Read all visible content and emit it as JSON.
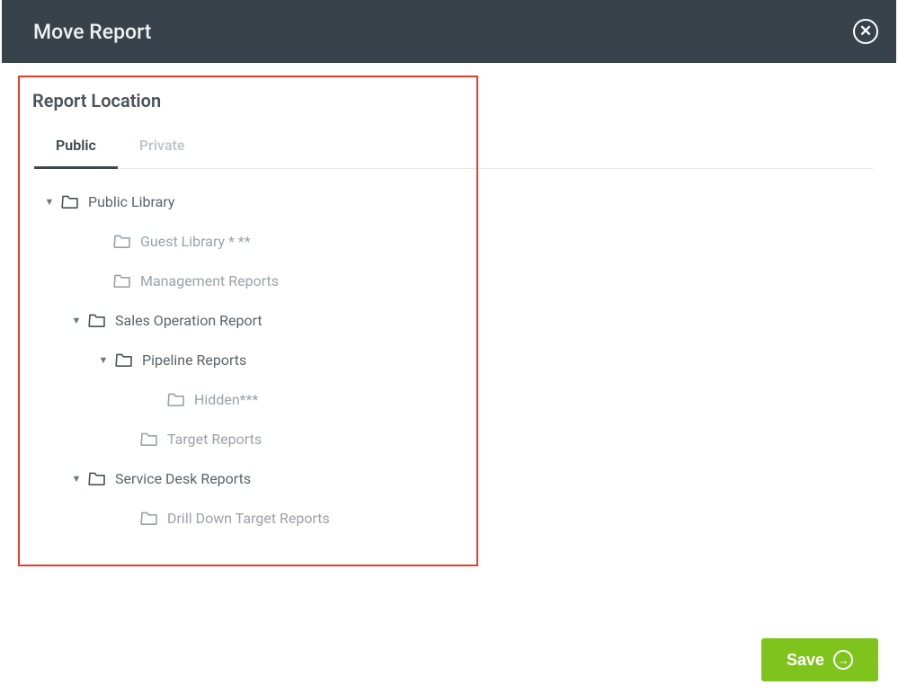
{
  "header": {
    "title": "Move Report"
  },
  "section": {
    "title": "Report Location"
  },
  "tabs": {
    "public": "Public",
    "private": "Private"
  },
  "tree": {
    "n0": "Public Library",
    "n1": "Guest Library * **",
    "n2": "Management Reports",
    "n3": "Sales Operation Report",
    "n4": "Pipeline Reports",
    "n5": "Hidden***",
    "n6": "Target Reports",
    "n7": "Service Desk Reports",
    "n8": "Drill Down Target Reports"
  },
  "footer": {
    "save": "Save"
  }
}
